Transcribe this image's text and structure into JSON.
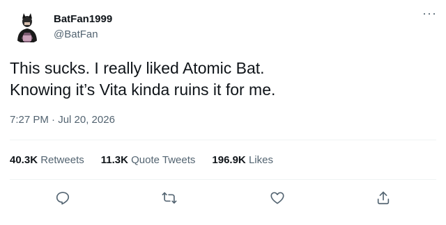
{
  "user": {
    "display_name": "BatFan1999",
    "handle": "@BatFan"
  },
  "tweet": {
    "lines": [
      "This sucks. I really liked Atomic Bat.",
      "Knowing it’s Vita kinda ruins it for me."
    ],
    "timestamp": "7:27 PM · Jul 20, 2026"
  },
  "stats": [
    {
      "number": "40.3K",
      "label": "Retweets"
    },
    {
      "number": "11.3K",
      "label": "Quote Tweets"
    },
    {
      "number": "196.9K",
      "label": "Likes"
    }
  ],
  "icons": {
    "more": "more-dots-icon",
    "reply": "reply-icon",
    "retweet": "retweet-icon",
    "like": "heart-icon",
    "share": "share-icon"
  },
  "colors": {
    "text": "#0f1419",
    "secondary": "#536471",
    "divider": "#eff3f4"
  }
}
